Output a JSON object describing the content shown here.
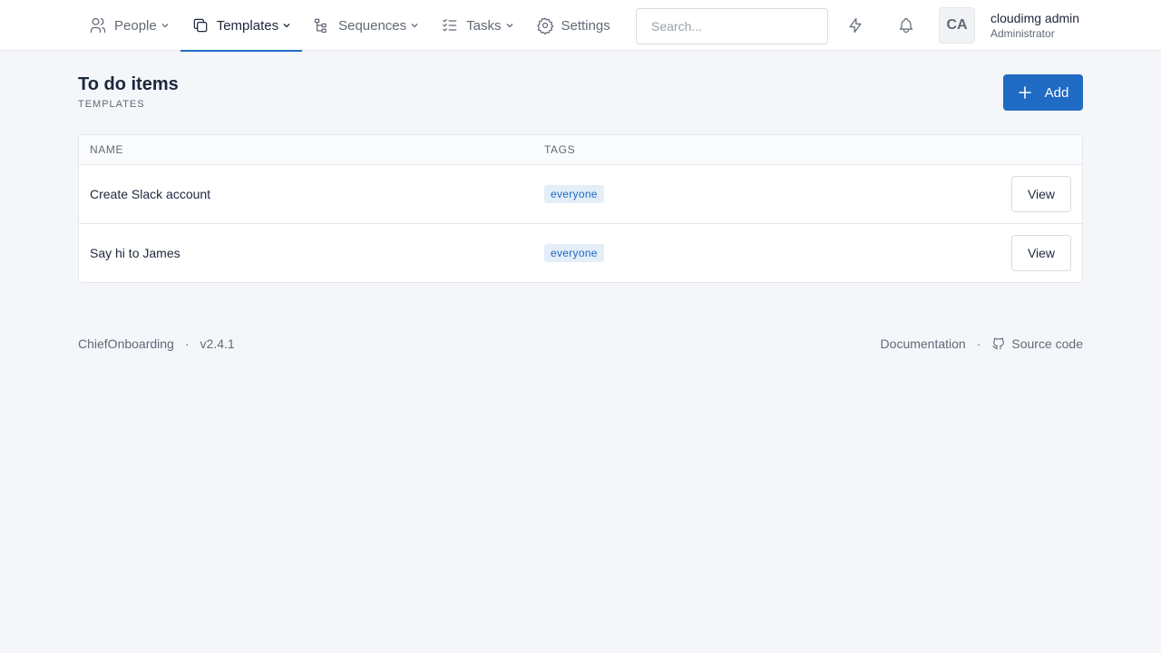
{
  "nav": {
    "items": [
      {
        "label": "People",
        "icon": "users-icon",
        "has_dropdown": true,
        "active": false
      },
      {
        "label": "Templates",
        "icon": "copy-icon",
        "has_dropdown": true,
        "active": true
      },
      {
        "label": "Sequences",
        "icon": "sitemap-icon",
        "has_dropdown": true,
        "active": false
      },
      {
        "label": "Tasks",
        "icon": "list-check-icon",
        "has_dropdown": true,
        "active": false
      },
      {
        "label": "Settings",
        "icon": "gear-icon",
        "has_dropdown": false,
        "active": false
      }
    ]
  },
  "search": {
    "placeholder": "Search...",
    "value": ""
  },
  "header_icons": [
    "bolt-icon",
    "bell-icon"
  ],
  "user": {
    "initials": "CA",
    "name": "cloudimg admin",
    "role": "Administrator"
  },
  "page": {
    "title": "To do items",
    "pretitle": "TEMPLATES",
    "add_label": "Add"
  },
  "table": {
    "columns": [
      "NAME",
      "TAGS"
    ],
    "rows": [
      {
        "name": "Create Slack account",
        "tag": "everyone",
        "action": "View"
      },
      {
        "name": "Say hi to James",
        "tag": "everyone",
        "action": "View"
      }
    ]
  },
  "footer": {
    "brand": "ChiefOnboarding",
    "version": "v2.4.1",
    "separator": "·",
    "documentation": "Documentation",
    "source_code": "Source code"
  },
  "colors": {
    "accent": "#206bc4",
    "tag_bg": "#e3eef9",
    "background": "#f4f6fa"
  }
}
